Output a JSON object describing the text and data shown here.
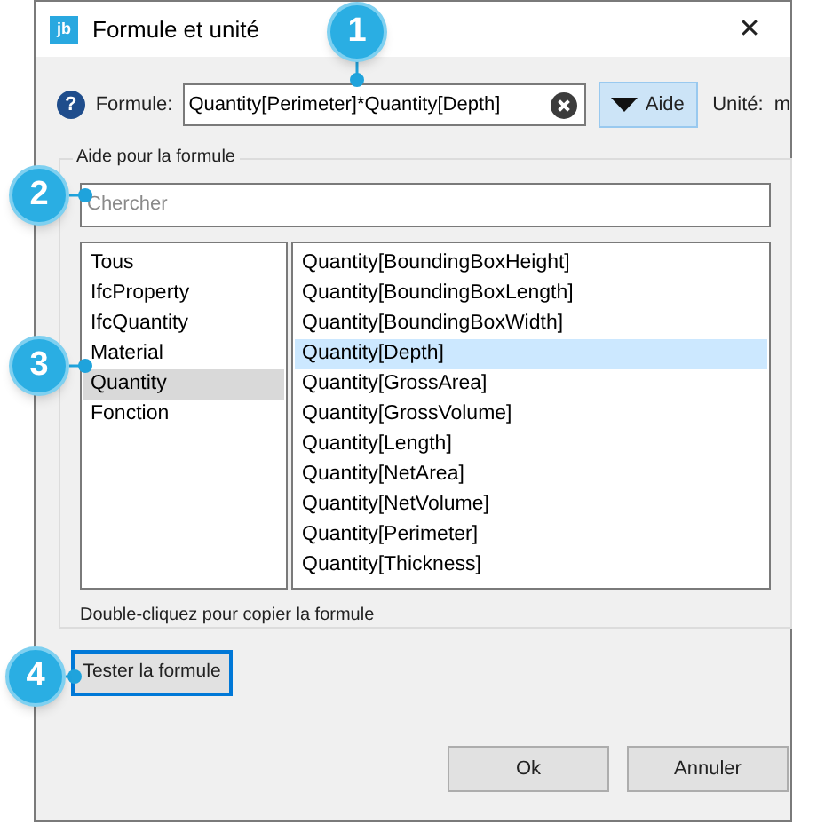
{
  "window": {
    "app_icon": "jb",
    "title": "Formule et unité",
    "close": "✕"
  },
  "formula": {
    "help": "?",
    "label": "Formule:",
    "value": "Quantity[Perimeter]*Quantity[Depth]",
    "help_button": "Aide",
    "unit_label": "Unité:",
    "unit_value": "m"
  },
  "help_group": {
    "legend": "Aide pour la formule",
    "search": {
      "placeholder": "Chercher"
    },
    "categories": [
      {
        "label": "Tous",
        "selected": false
      },
      {
        "label": "IfcProperty",
        "selected": false
      },
      {
        "label": "IfcQuantity",
        "selected": false
      },
      {
        "label": "Material",
        "selected": false
      },
      {
        "label": "Quantity",
        "selected": true
      },
      {
        "label": "Fonction",
        "selected": false
      }
    ],
    "items": [
      {
        "label": "Quantity[BoundingBoxHeight]",
        "selected": false
      },
      {
        "label": "Quantity[BoundingBoxLength]",
        "selected": false
      },
      {
        "label": "Quantity[BoundingBoxWidth]",
        "selected": false
      },
      {
        "label": "Quantity[Depth]",
        "selected": true
      },
      {
        "label": "Quantity[GrossArea]",
        "selected": false
      },
      {
        "label": "Quantity[GrossVolume]",
        "selected": false
      },
      {
        "label": "Quantity[Length]",
        "selected": false
      },
      {
        "label": "Quantity[NetArea]",
        "selected": false
      },
      {
        "label": "Quantity[NetVolume]",
        "selected": false
      },
      {
        "label": "Quantity[Perimeter]",
        "selected": false
      },
      {
        "label": "Quantity[Thickness]",
        "selected": false
      }
    ],
    "hint": "Double-cliquez pour copier la formule"
  },
  "test_button": "Tester la formule",
  "buttons": [
    {
      "label": "Ok"
    },
    {
      "label": "Annuler"
    }
  ],
  "callouts": [
    {
      "number": "1"
    },
    {
      "number": "2"
    },
    {
      "number": "3"
    },
    {
      "number": "4"
    }
  ]
}
